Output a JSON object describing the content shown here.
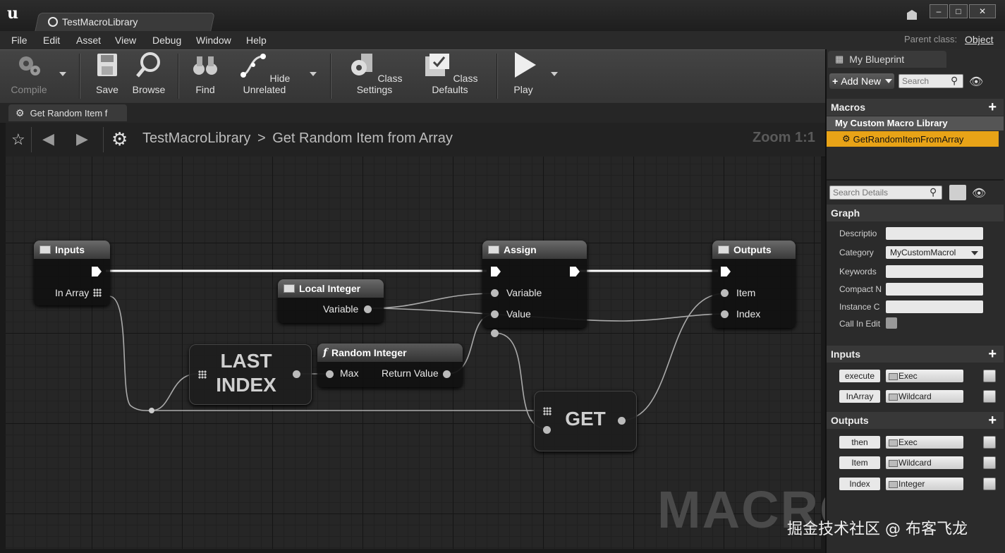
{
  "window": {
    "tab_title": "TestMacroLibrary"
  },
  "menu": [
    "File",
    "Edit",
    "Asset",
    "View",
    "Debug",
    "Window",
    "Help"
  ],
  "parent_class": {
    "label": "Parent class:",
    "value": "Object"
  },
  "toolbar": {
    "compile": "Compile",
    "save": "Save",
    "browse": "Browse",
    "find": "Find",
    "hide_unrelated": "Hide Unrelated",
    "class_settings": "Class Settings",
    "class_defaults": "Class Defaults",
    "play": "Play"
  },
  "graph_tab": "Get Random Item f",
  "breadcrumb": {
    "root": "TestMacroLibrary",
    "separator": ">",
    "current": "Get Random Item from Array"
  },
  "zoom": "Zoom 1:1",
  "watermark_graph": "MACRO",
  "nodes": {
    "inputs": {
      "title": "Inputs",
      "pin_in_array": "In Array"
    },
    "assign": {
      "title": "Assign",
      "pin_variable": "Variable",
      "pin_value": "Value"
    },
    "outputs": {
      "title": "Outputs",
      "pin_item": "Item",
      "pin_index": "Index"
    },
    "local_integer": {
      "title": "Local Integer",
      "pin_variable": "Variable"
    },
    "random_integer": {
      "title": "Random Integer",
      "pin_max": "Max",
      "pin_return": "Return Value"
    },
    "last_index": {
      "line1": "LAST",
      "line2": "INDEX"
    },
    "get": {
      "label": "GET"
    }
  },
  "my_blueprint": {
    "tab": "My Blueprint",
    "add_new": "Add New",
    "search_placeholder": "Search",
    "macros_header": "Macros",
    "category": "My Custom Macro Library",
    "selected_macro": "GetRandomItemFromArray"
  },
  "details": {
    "search_placeholder": "Search Details",
    "graph_header": "Graph",
    "fields": [
      {
        "label": "Descriptio",
        "value": ""
      },
      {
        "label": "Category",
        "value": "MyCustomMacrol"
      },
      {
        "label": "Keywords",
        "value": ""
      },
      {
        "label": "Compact N",
        "value": ""
      },
      {
        "label": "Instance C",
        "value": ""
      },
      {
        "label": "Call In Edit",
        "value": ""
      }
    ],
    "inputs_header": "Inputs",
    "inputs": [
      {
        "name": "execute",
        "type": "Exec"
      },
      {
        "name": "InArray",
        "type": "Wildcard"
      }
    ],
    "outputs_header": "Outputs",
    "outputs": [
      {
        "name": "then",
        "type": "Exec"
      },
      {
        "name": "Item",
        "type": "Wildcard"
      },
      {
        "name": "Index",
        "type": "Integer"
      }
    ]
  },
  "site_watermark": "掘金技术社区 @ 布客飞龙",
  "colors": {
    "accent_selected": "#e8a317",
    "background": "#262626"
  }
}
